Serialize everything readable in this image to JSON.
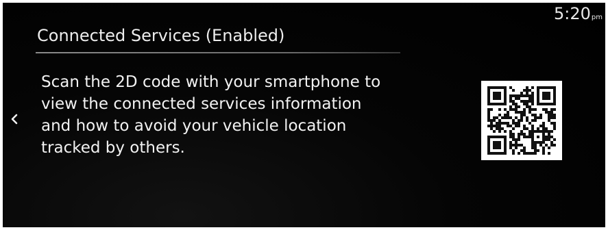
{
  "status": {
    "time": "5:20",
    "ampm": "pm"
  },
  "header": {
    "title": "Connected Services (Enabled)"
  },
  "body": {
    "lines": [
      "Scan the 2D code with your smartphone to",
      "view the connected services information",
      "and how to avoid your vehicle location",
      "tracked by others."
    ]
  },
  "icons": {
    "back": "chevron-left-icon",
    "code": "qr-code-icon"
  },
  "colors": {
    "background": "#000000",
    "text": "#f2f2f2"
  }
}
